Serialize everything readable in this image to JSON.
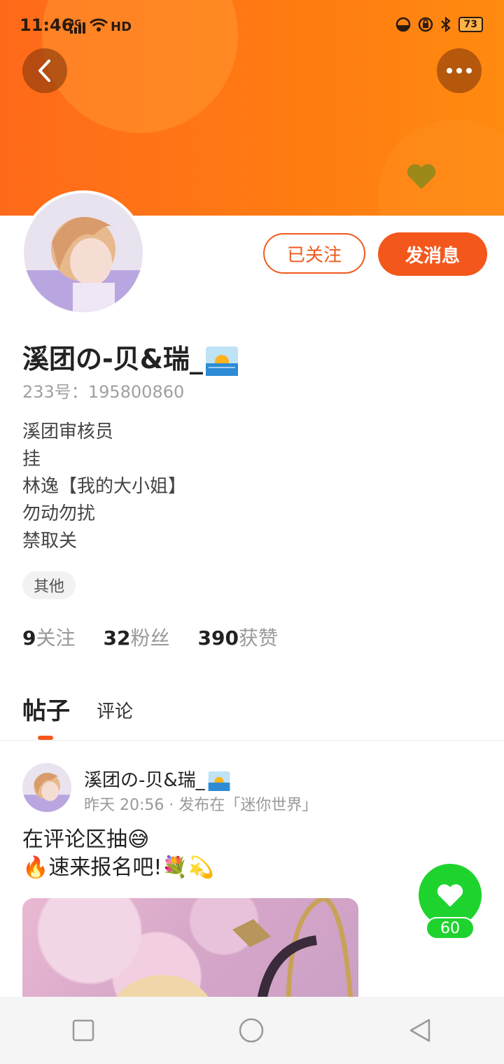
{
  "status_bar": {
    "time": "11:46",
    "signal_text": "4G",
    "wifi_text": "HD",
    "battery": "73"
  },
  "header": {
    "back_icon": "chevron-left-icon",
    "more_icon": "more-dots-icon",
    "accent": "#ff7411"
  },
  "actions": {
    "followed_label": "已关注",
    "message_label": "发消息",
    "accent": "#f4571b"
  },
  "profile": {
    "nickname": "溪团の-贝&瑞_",
    "uid": "233号：195800860",
    "bio": [
      "溪团审核员",
      "挂",
      "林逸【我的大小姐】",
      "勿动勿扰",
      "禁取关"
    ],
    "tag": "其他",
    "stats": {
      "following_count": "9",
      "following_label": "关注",
      "fans_count": "32",
      "fans_label": "粉丝",
      "likes_count": "390",
      "likes_label": "获赞"
    }
  },
  "tabs": {
    "posts": "帖子",
    "comments": "评论"
  },
  "post": {
    "author": "溪团の-贝&瑞_",
    "meta": "昨天 20:56 · 发布在「迷你世界」",
    "line1": "在评论区抽😅",
    "line2": "🔥速来报名吧!💐💫",
    "like_count": "60",
    "like_color": "#1ed32e"
  },
  "navbar": {
    "recent_icon": "square-icon",
    "home_icon": "circle-icon",
    "back_icon": "triangle-back-icon"
  }
}
